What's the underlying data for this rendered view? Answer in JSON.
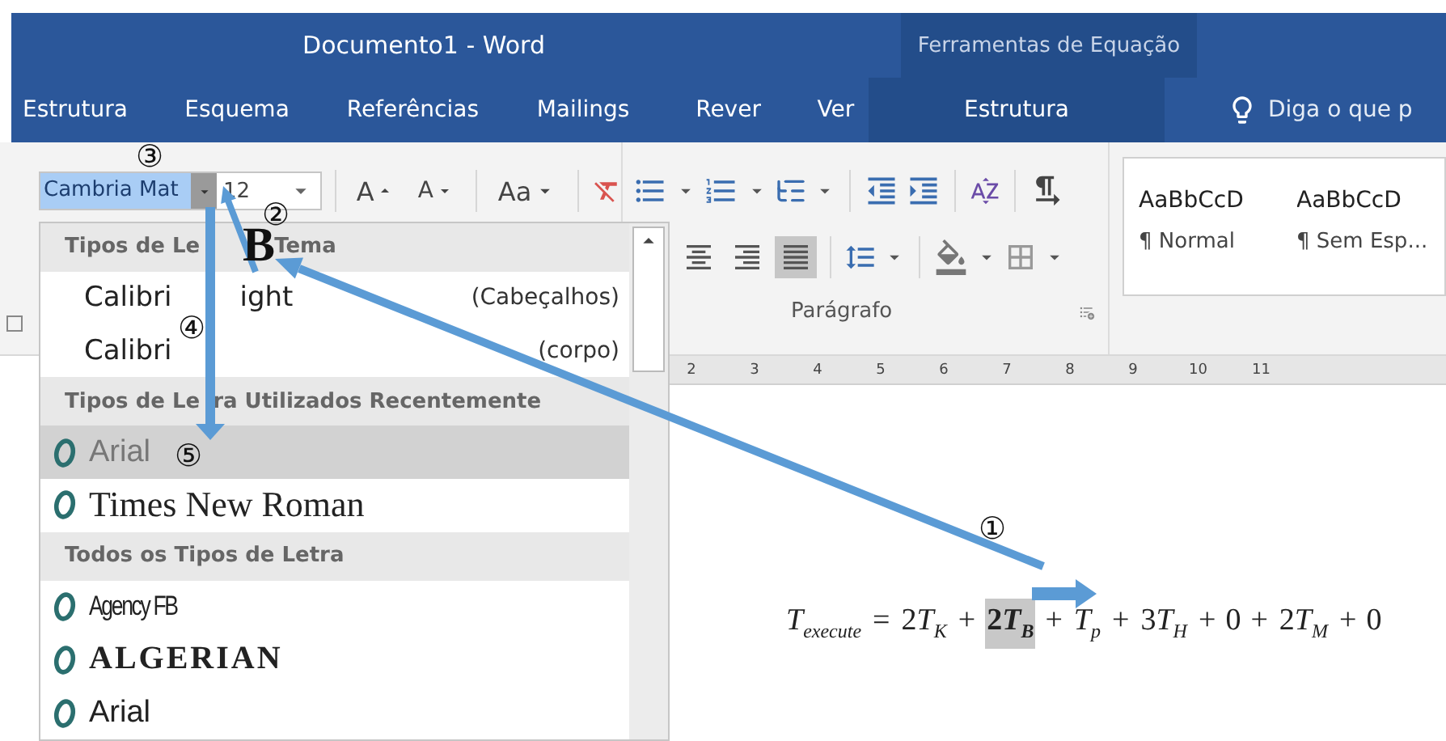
{
  "window": {
    "title": "Documento1 - Word",
    "context_title": "Ferramentas de Equação"
  },
  "tabs": [
    {
      "label": "Estrutura",
      "selected": false
    },
    {
      "label": "Esquema",
      "selected": false
    },
    {
      "label": "Referências",
      "selected": false
    },
    {
      "label": "Mailings",
      "selected": false
    },
    {
      "label": "Rever",
      "selected": false
    },
    {
      "label": "Ver",
      "selected": false
    }
  ],
  "context_tabs": [
    {
      "label": "Estrutura",
      "selected": false
    }
  ],
  "tell_me": {
    "placeholder": "Diga o que p"
  },
  "font": {
    "name": "Cambria Mat",
    "size": "12",
    "expanded": true,
    "grow_label": "A",
    "shrink_label": "A",
    "case_label": "Aa"
  },
  "align_buttons": [
    {
      "kind": "center",
      "selected": false
    },
    {
      "kind": "right",
      "selected": false
    },
    {
      "kind": "justify",
      "selected": true
    }
  ],
  "paragraph_label": "Parágrafo",
  "styles": [
    {
      "sample": "AaBbCcD",
      "name": "¶ Normal"
    },
    {
      "sample": "AaBbCcD",
      "name": "¶ Sem Esp..."
    }
  ],
  "ruler": [
    "2",
    "3",
    "4",
    "5",
    "6",
    "7",
    "8",
    "9",
    "10",
    "11"
  ],
  "font_menu": {
    "sections": [
      {
        "title": [
          "Tipos de Le",
          "Tema"
        ],
        "items": [
          {
            "name": [
              "Calibri",
              "ight"
            ],
            "note": "(Cabeçalhos)",
            "kind": "sans",
            "opentype": false,
            "selected": false
          },
          {
            "name": "Calibri",
            "note": "(corpo)",
            "kind": "sans",
            "opentype": false,
            "selected": false
          }
        ]
      },
      {
        "title": [
          "Tipos de Le",
          "ra Utilizados Recentemente"
        ],
        "items": [
          {
            "name": "Arial",
            "kind": "sans",
            "opentype": true,
            "selected": true
          },
          {
            "name": "Times New Roman",
            "kind": "serif",
            "opentype": true,
            "selected": false
          }
        ]
      },
      {
        "title": "Todos os Tipos de Letra",
        "items": [
          {
            "name": "Agency FB",
            "kind": "condensed",
            "opentype": true,
            "selected": false
          },
          {
            "name": "ALGERIAN",
            "kind": "decorative",
            "opentype": true,
            "selected": false
          },
          {
            "name": "Arial",
            "kind": "sans",
            "opentype": true,
            "selected": false
          }
        ]
      }
    ]
  },
  "equation": [
    {
      "kind": "term",
      "base": "T",
      "sub": "execute",
      "selected": false
    },
    {
      "kind": "op",
      "text": "="
    },
    {
      "kind": "term",
      "coef": "2",
      "base": "T",
      "sub": "K",
      "selected": false
    },
    {
      "kind": "op",
      "text": "+"
    },
    {
      "kind": "term",
      "coef": "2",
      "base": "T",
      "sub": "B",
      "selected": true
    },
    {
      "kind": "op",
      "text": "+"
    },
    {
      "kind": "term",
      "base": "T",
      "sub": "p",
      "selected": false
    },
    {
      "kind": "op",
      "text": "+"
    },
    {
      "kind": "term",
      "coef": "3",
      "base": "T",
      "sub": "H",
      "selected": false
    },
    {
      "kind": "op",
      "text": "+"
    },
    {
      "kind": "number",
      "text": "0"
    },
    {
      "kind": "op",
      "text": "+"
    },
    {
      "kind": "term",
      "coef": "2",
      "base": "T",
      "sub": "M",
      "selected": false
    },
    {
      "kind": "op",
      "text": "+"
    },
    {
      "kind": "number",
      "text": "0"
    }
  ],
  "annotations": {
    "markers": [
      "①",
      "②",
      "③",
      "④",
      "⑤"
    ],
    "letter": "B"
  }
}
